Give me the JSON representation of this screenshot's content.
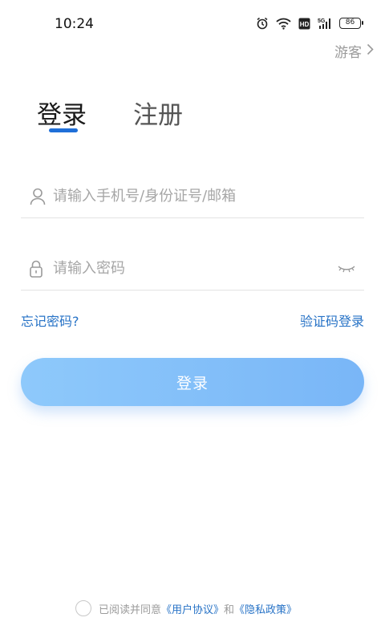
{
  "status_bar": {
    "time": "10:24",
    "battery": "86",
    "icons": [
      "alarm-icon",
      "wifi-icon",
      "hd-icon",
      "signal-5g-icon",
      "battery-icon"
    ]
  },
  "header": {
    "guest_label": "游客",
    "guest_icon": "chevron-right-icon"
  },
  "tabs": [
    {
      "label": "登录",
      "active": true
    },
    {
      "label": "注册",
      "active": false
    }
  ],
  "form": {
    "account": {
      "placeholder": "请输入手机号/身份证号/邮箱",
      "value": "",
      "icon": "user-icon"
    },
    "password": {
      "placeholder": "请输入密码",
      "value": "",
      "icon": "lock-icon",
      "toggle_icon": "eye-closed-icon"
    },
    "forgot_label": "忘记密码?",
    "code_login_label": "验证码登录",
    "submit_label": "登录"
  },
  "agreement": {
    "prefix": "已阅读并同意",
    "user_agreement": "《用户协议》",
    "conjunction": "和",
    "privacy_policy": "《隐私政策》",
    "checked": false
  },
  "colors": {
    "accent": "#1f6fd8",
    "link": "#2672c6",
    "button_start": "#8ec9fb",
    "button_end": "#79b6f7",
    "placeholder": "#a6a6a6"
  }
}
